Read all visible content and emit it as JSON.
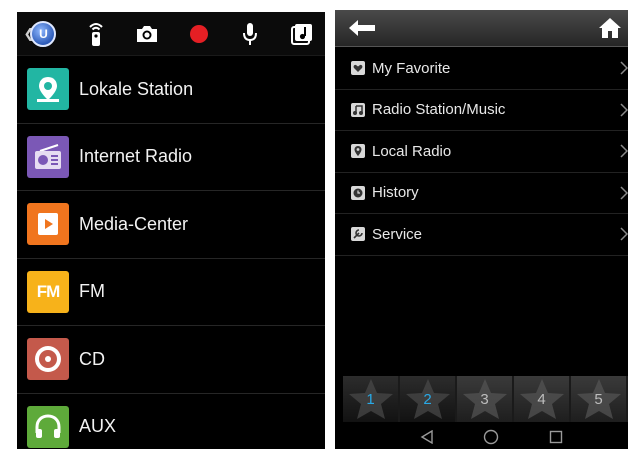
{
  "left": {
    "toolbar": {
      "icons": [
        "chevron-left-icon",
        "app-logo-icon",
        "remote-icon",
        "camera-icon",
        "record-icon",
        "microphone-icon",
        "music-note-icon"
      ],
      "logo_letter": "U",
      "record_color": "#e51f24"
    },
    "items": [
      {
        "label": "Lokale Station",
        "icon": "map-pin-icon",
        "color": "#22b6a3"
      },
      {
        "label": "Internet Radio",
        "icon": "radio-icon",
        "color": "#7b58b6"
      },
      {
        "label": "Media-Center",
        "icon": "play-icon",
        "color": "#f0751e"
      },
      {
        "label": "FM",
        "icon": "fm-icon",
        "color": "#f7b21a"
      },
      {
        "label": "CD",
        "icon": "disc-icon",
        "color": "#c4594b"
      },
      {
        "label": "AUX",
        "icon": "headphones-icon",
        "color": "#5eaa3a"
      }
    ]
  },
  "right": {
    "header": {
      "back_icon": "arrow-left-icon",
      "home_icon": "home-icon"
    },
    "menu": [
      {
        "label": "My Favorite",
        "icon": "heart-box-icon"
      },
      {
        "label": "Radio Station/Music",
        "icon": "music-note-icon"
      },
      {
        "label": "Local Radio",
        "icon": "pin-icon"
      },
      {
        "label": "History",
        "icon": "clock-icon"
      },
      {
        "label": "Service",
        "icon": "service-icon"
      }
    ],
    "presets": [
      {
        "num": "1",
        "active": true
      },
      {
        "num": "2",
        "active": true
      },
      {
        "num": "3",
        "active": false
      },
      {
        "num": "4",
        "active": false
      },
      {
        "num": "5",
        "active": false
      }
    ],
    "accent": "#29a9e6",
    "navbar": [
      "back-triangle-icon",
      "home-circle-icon",
      "recents-square-icon"
    ]
  }
}
